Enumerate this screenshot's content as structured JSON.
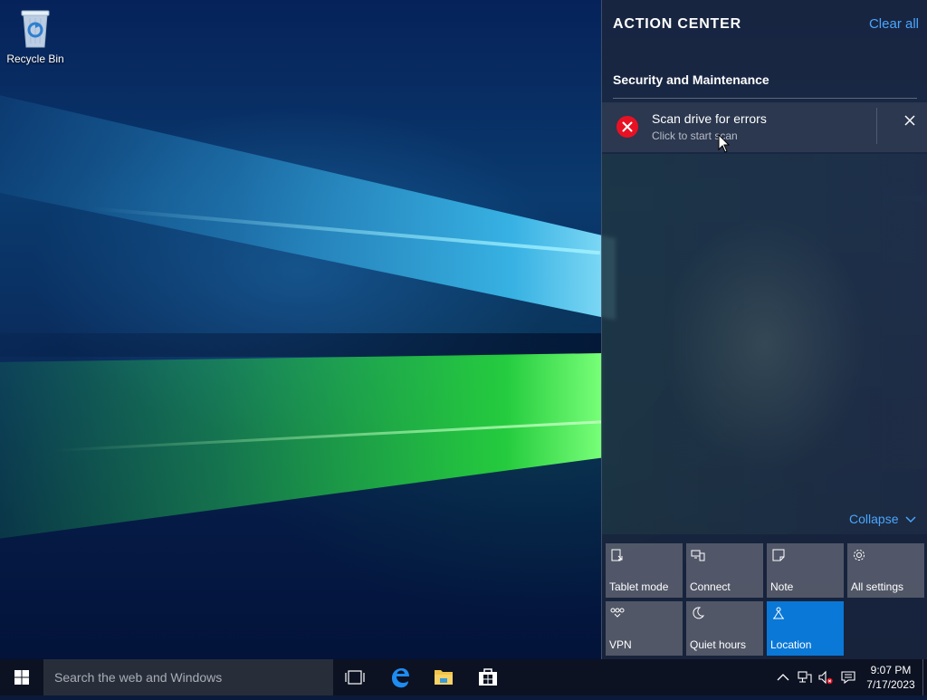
{
  "desktop": {
    "icons": [
      {
        "label": "Recycle Bin",
        "icon": "recycle-bin-icon"
      }
    ]
  },
  "action_center": {
    "title": "ACTION CENTER",
    "clear_all": "Clear all",
    "group": "Security and Maintenance",
    "notification": {
      "title": "Scan drive for errors",
      "body": "Click to start scan",
      "icon": "error-icon"
    },
    "collapse": "Collapse",
    "quick_actions": [
      {
        "label": "Tablet mode",
        "icon": "tablet-mode-icon",
        "active": false
      },
      {
        "label": "Connect",
        "icon": "connect-icon",
        "active": false
      },
      {
        "label": "Note",
        "icon": "note-icon",
        "active": false
      },
      {
        "label": "All settings",
        "icon": "gear-icon",
        "active": false
      },
      {
        "label": "VPN",
        "icon": "vpn-icon",
        "active": false
      },
      {
        "label": "Quiet hours",
        "icon": "moon-icon",
        "active": false
      },
      {
        "label": "Location",
        "icon": "location-icon",
        "active": true
      }
    ],
    "accent_color": "#0a78d7",
    "link_color": "#4aa6ff"
  },
  "taskbar": {
    "search_placeholder": "Search the web and Windows",
    "pinned": [
      "task-view-icon",
      "edge-icon",
      "file-explorer-icon",
      "store-icon"
    ],
    "tray": [
      "chevron-up-icon",
      "network-icon",
      "volume-muted-icon",
      "action-center-icon"
    ],
    "time": "9:07 PM",
    "date": "7/17/2023"
  }
}
